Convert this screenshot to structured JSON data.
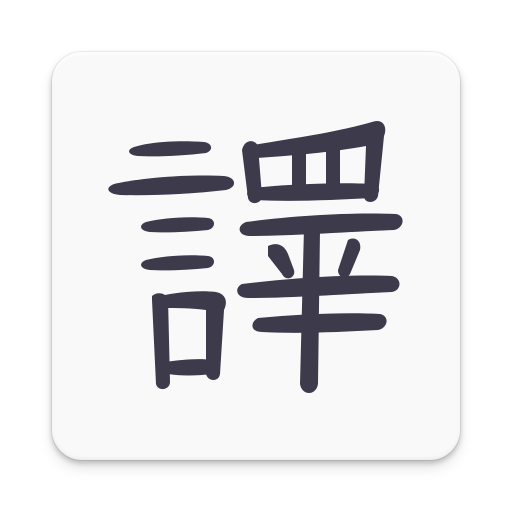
{
  "app_icon": {
    "glyph_text": "譯",
    "glyph_meaning": "translate",
    "background_color": "#f9f9f9",
    "glyph_color": "#3c3a4b"
  }
}
